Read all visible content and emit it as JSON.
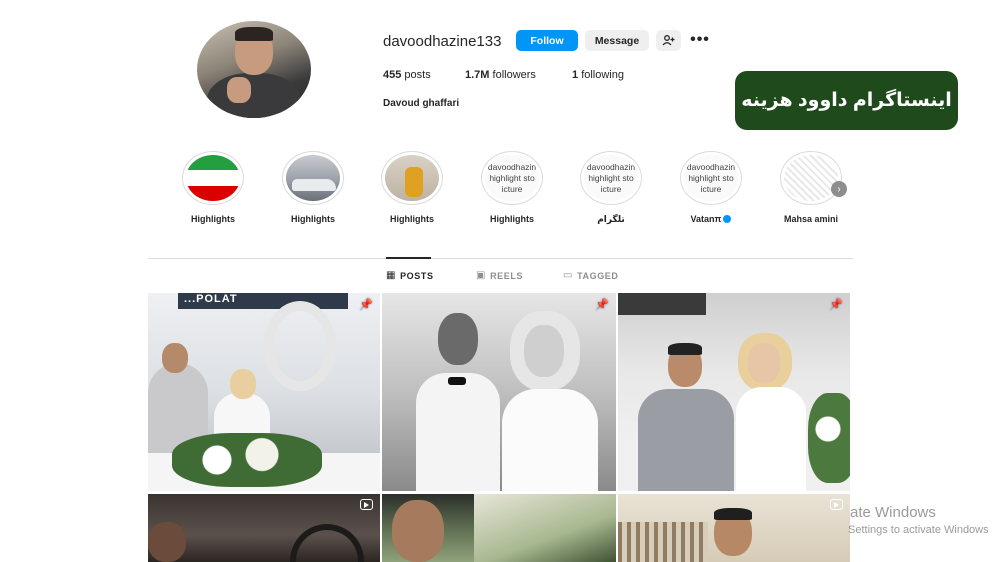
{
  "profile": {
    "username": "davoodhazine133",
    "follow_label": "Follow",
    "message_label": "Message",
    "add_user_icon": "add-user-icon",
    "more_icon": "more-options-icon",
    "posts_count": "455",
    "posts_label": "posts",
    "followers_count": "1.7M",
    "followers_label": "followers",
    "following_count": "1",
    "following_label": "following",
    "full_name": "Davoud ghaffari"
  },
  "banner": {
    "text": "اینستاگرام داوود هزینه",
    "background": "#1f4a1b"
  },
  "highlights": [
    {
      "label": "Highlights",
      "thumb": "iran-flag"
    },
    {
      "label": "Highlights",
      "thumb": "car"
    },
    {
      "label": "Highlights",
      "thumb": "person"
    },
    {
      "label": "Highlights",
      "thumb": "broken-image",
      "alt_lines": [
        "davoodhazin",
        "highlight sto",
        "icture"
      ]
    },
    {
      "label": "تلگرام",
      "thumb": "broken-image",
      "alt_lines": [
        "davoodhazin",
        "highlight sto",
        "icture"
      ]
    },
    {
      "label": "Vatanπ",
      "thumb": "broken-image",
      "alt_lines": [
        "davoodhazin",
        "highlight sto",
        "icture"
      ],
      "badge_icon": "verified-icon"
    },
    {
      "label": "Mahsa amini",
      "thumb": "sketch"
    }
  ],
  "tabs": [
    {
      "label": "POSTS",
      "icon": "grid-icon",
      "active": true
    },
    {
      "label": "REELS",
      "icon": "reels-icon",
      "active": false
    },
    {
      "label": "TAGGED",
      "icon": "tagged-icon",
      "active": false
    }
  ],
  "posts": [
    {
      "type": "pinned",
      "icon": "pin-icon",
      "sign_text": "...POLAT"
    },
    {
      "type": "pinned",
      "icon": "pin-icon"
    },
    {
      "type": "pinned",
      "icon": "pin-icon"
    },
    {
      "type": "reel",
      "icon": "reel-icon"
    },
    {
      "type": "photo"
    },
    {
      "type": "reel",
      "icon": "reel-icon"
    }
  ],
  "watermark": {
    "line1": "ate Windows",
    "line2": "Settings to activate Windows"
  },
  "colors": {
    "accent": "#0095f6",
    "banner": "#1f4a1b",
    "text": "#262626",
    "muted": "#8e8e8e"
  }
}
